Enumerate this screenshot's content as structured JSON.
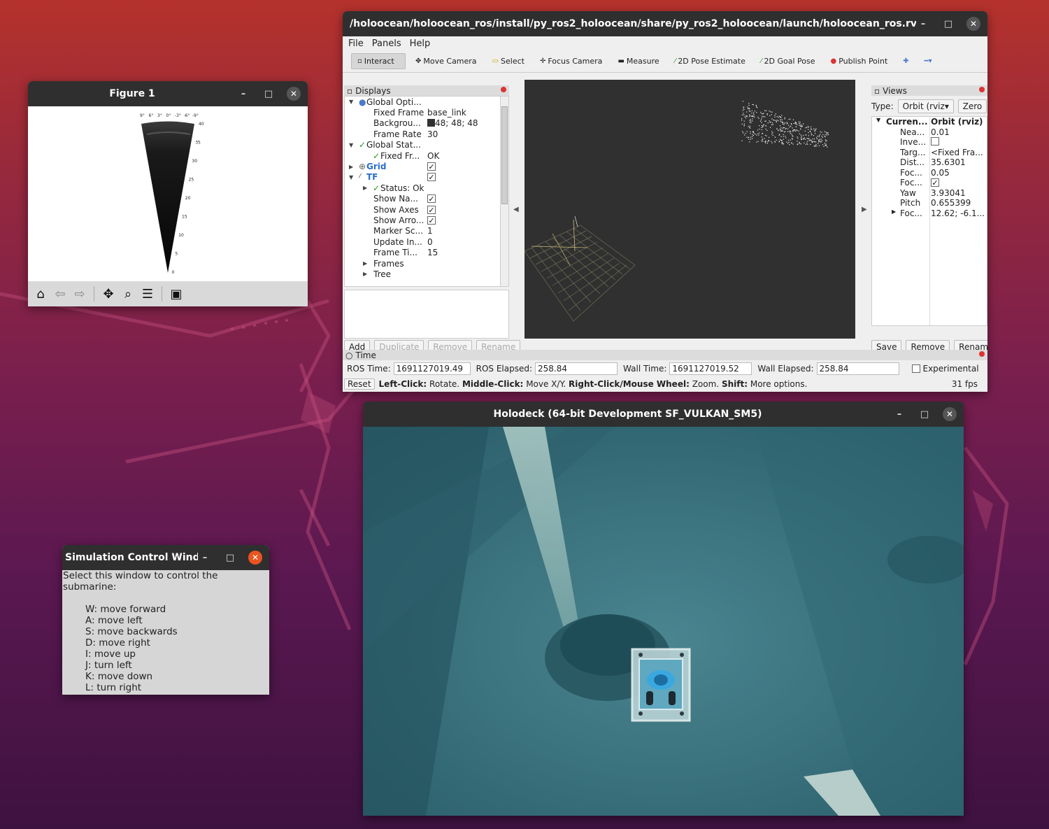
{
  "figure": {
    "title": "Figure 1",
    "angle_labels": [
      "9°",
      "6°",
      "3°",
      "0°",
      "-3°",
      "-6°",
      "-9°"
    ],
    "range_labels": [
      "40",
      "35",
      "30",
      "25",
      "20",
      "15",
      "10",
      "5",
      "0"
    ],
    "toolbar_icons": [
      "home-icon",
      "back-arrow-icon",
      "forward-arrow-icon",
      "pan-icon",
      "zoom-icon",
      "configure-icon",
      "save-icon"
    ]
  },
  "rviz": {
    "title": "/holoocean/holoocean_ros/install/py_ros2_holoocean/share/py_ros2_holoocean/launch/holoocean_ros.rviz* - RViz",
    "menu": [
      "File",
      "Panels",
      "Help"
    ],
    "tools": [
      "Interact",
      "Move Camera",
      "Select",
      "Focus Camera",
      "Measure",
      "2D Pose Estimate",
      "2D Goal Pose",
      "Publish Point"
    ],
    "displays": {
      "header": "Displays",
      "rows": [
        {
          "key": "Global Opti...",
          "value": ""
        },
        {
          "key": "Fixed Frame",
          "value": "base_link"
        },
        {
          "key": "Backgrou...",
          "value": "48; 48; 48"
        },
        {
          "key": "Frame Rate",
          "value": "30"
        },
        {
          "key": "Global Stat...",
          "value": ""
        },
        {
          "key": "Fixed Fr...",
          "value": "OK"
        },
        {
          "key": "Grid",
          "value": ""
        },
        {
          "key": "TF",
          "value": ""
        },
        {
          "key": "Status: Ok",
          "value": ""
        },
        {
          "key": "Show Na...",
          "value": ""
        },
        {
          "key": "Show Axes",
          "value": ""
        },
        {
          "key": "Show Arro...",
          "value": ""
        },
        {
          "key": "Marker Sc...",
          "value": "1"
        },
        {
          "key": "Update In...",
          "value": "0"
        },
        {
          "key": "Frame Ti...",
          "value": "15"
        },
        {
          "key": "Frames",
          "value": ""
        },
        {
          "key": "Tree",
          "value": ""
        }
      ],
      "buttons": [
        "Add",
        "Duplicate",
        "Remove",
        "Rename"
      ]
    },
    "views": {
      "header": "Views",
      "type_label": "Type:",
      "type_value": "Orbit (rviz",
      "zero": "Zero",
      "rows": [
        {
          "key": "Curren...",
          "value": "Orbit (rviz)"
        },
        {
          "key": "Nea...",
          "value": "0.01"
        },
        {
          "key": "Inve...",
          "value": ""
        },
        {
          "key": "Targ...",
          "value": "<Fixed Fra..."
        },
        {
          "key": "Dist...",
          "value": "35.6301"
        },
        {
          "key": "Foc...",
          "value": "0.05"
        },
        {
          "key": "Foc...",
          "value": ""
        },
        {
          "key": "Yaw",
          "value": "3.93041"
        },
        {
          "key": "Pitch",
          "value": "0.655399"
        },
        {
          "key": "Foc...",
          "value": "12.62; -6.1..."
        }
      ],
      "buttons": [
        "Save",
        "Remove",
        "Rename"
      ]
    },
    "time": {
      "header": "Time",
      "ros_time_label": "ROS Time:",
      "ros_time": "1691127019.49",
      "ros_elapsed_label": "ROS Elapsed:",
      "ros_elapsed": "258.84",
      "wall_time_label": "Wall Time:",
      "wall_time": "1691127019.52",
      "wall_elapsed_label": "Wall Elapsed:",
      "wall_elapsed": "258.84",
      "experimental": "Experimental",
      "reset": "Reset",
      "hint_left": "Left-Click:",
      "hint_left_t": "Rotate.",
      "hint_mid": "Middle-Click:",
      "hint_mid_t": "Move X/Y.",
      "hint_right": "Right-Click/Mouse Wheel:",
      "hint_right_t": "Zoom.",
      "hint_shift": "Shift:",
      "hint_shift_t": "More options.",
      "fps": "31 fps"
    },
    "colors": {
      "background_swatch": "#303030"
    }
  },
  "holodeck": {
    "title": "Holodeck (64-bit Development SF_VULKAN_SM5)"
  },
  "sim": {
    "title": "Simulation Control Wind...",
    "header": "Select this window to control the submarine:",
    "keys": [
      "W: move forward",
      "A: move left",
      "S: move backwards",
      "D: move right",
      "I: move up",
      "J: turn left",
      "K: move down",
      "L: turn right"
    ]
  }
}
